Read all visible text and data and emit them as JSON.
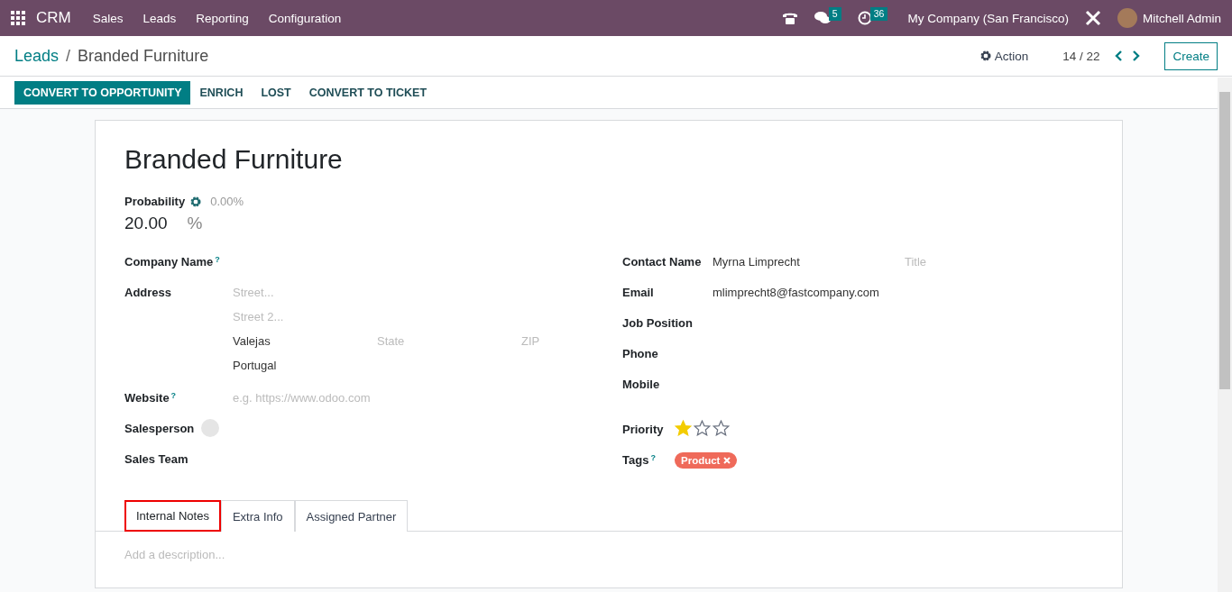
{
  "navbar": {
    "app_name": "CRM",
    "menu": [
      "Sales",
      "Leads",
      "Reporting",
      "Configuration"
    ],
    "messages_count": "5",
    "activities_count": "36",
    "company": "My Company (San Francisco)",
    "user": "Mitchell Admin"
  },
  "control_panel": {
    "breadcrumb": [
      "Leads",
      "Branded Furniture"
    ],
    "breadcrumb_separator": "/",
    "action": "Action",
    "pager": "14 / 22",
    "create": "Create"
  },
  "status_buttons": [
    {
      "label": "CONVERT TO OPPORTUNITY",
      "primary": true
    },
    {
      "label": "ENRICH",
      "primary": false
    },
    {
      "label": "LOST",
      "primary": false
    },
    {
      "label": "CONVERT TO TICKET",
      "primary": false
    }
  ],
  "form": {
    "title": "Branded Furniture",
    "probability": {
      "label": "Probability",
      "auto_value": "0.00%",
      "value": "20.00",
      "unit": "%"
    },
    "left_fields": [
      {
        "kind": "text",
        "label": "Company Name",
        "help": "?"
      },
      {
        "kind": "address",
        "label": "Address",
        "street": {
          "placeholder": "Street..."
        },
        "street2": {
          "placeholder": "Street 2..."
        },
        "city": {
          "value": "Valejas"
        },
        "state": {
          "placeholder": "State"
        },
        "zip": {
          "placeholder": "ZIP"
        },
        "country": {
          "value": "Portugal"
        }
      },
      {
        "kind": "text",
        "label": "Website",
        "help": "?",
        "placeholder": "e.g. https://www.odoo.com"
      },
      {
        "kind": "avatar",
        "label": "Salesperson"
      },
      {
        "kind": "text",
        "label": "Sales Team"
      }
    ],
    "right_fields": [
      {
        "kind": "contact",
        "label": "Contact Name",
        "value": "Myrna Limprecht",
        "title_placeholder": "Title"
      },
      {
        "kind": "text",
        "label": "Email",
        "value": "mlimprecht8@fastcompany.com"
      },
      {
        "kind": "text",
        "label": "Job Position"
      },
      {
        "kind": "text",
        "label": "Phone"
      },
      {
        "kind": "text",
        "label": "Mobile"
      },
      {
        "kind": "priority",
        "label": "Priority",
        "stars": 1
      },
      {
        "kind": "tags",
        "label": "Tags",
        "help": "?",
        "tags": [
          {
            "label": "Product",
            "color": "#ef6a5a"
          }
        ]
      }
    ],
    "tabs": [
      {
        "label": "Internal Notes",
        "selected": true,
        "highlighted": true
      },
      {
        "label": "Extra Info",
        "selected": false,
        "highlighted": false
      },
      {
        "label": "Assigned Partner",
        "selected": false,
        "highlighted": false
      }
    ],
    "description": {
      "placeholder": "Add a description..."
    }
  }
}
